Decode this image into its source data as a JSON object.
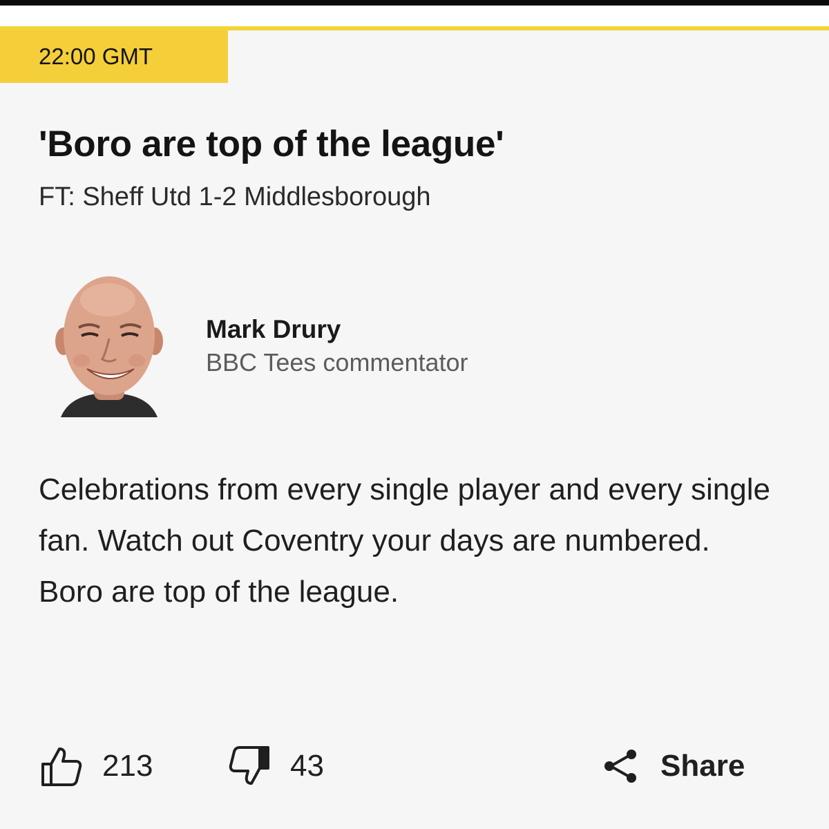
{
  "post": {
    "time": "22:00 GMT",
    "headline": "'Boro are top of the league'",
    "subheadline": "FT: Sheff Utd 1-2 Middlesborough",
    "author": {
      "name": "Mark Drury",
      "role": "BBC Tees commentator"
    },
    "body": "Celebrations from every single player and every single fan. Watch out Coventry your days are numbered. Boro are top of the league."
  },
  "actions": {
    "likes": "213",
    "dislikes": "43",
    "share_label": "Share"
  },
  "icons": {
    "like": "thumbs-up-icon",
    "dislike": "thumbs-down-icon",
    "share": "share-icon"
  },
  "colors": {
    "accent": "#f5cf3a",
    "background": "#f6f6f6",
    "text": "#141414"
  }
}
